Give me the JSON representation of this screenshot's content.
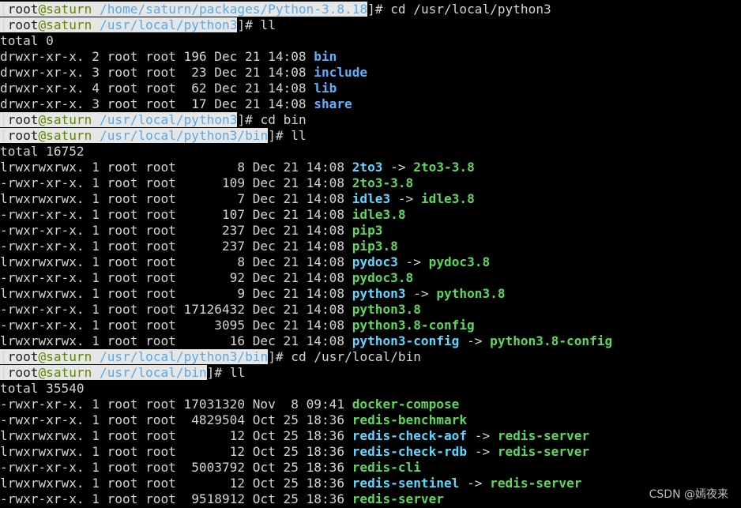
{
  "terminal": {
    "lines": [
      {
        "type": "prompt",
        "user": "root",
        "host": "saturn",
        "path": "/home/saturn/packages/Python-3.8.18",
        "cmd": "cd /usr/local/python3"
      },
      {
        "type": "prompt",
        "user": "root",
        "host": "saturn",
        "path": "/usr/local/python3",
        "cmd": "ll"
      },
      {
        "type": "text",
        "text": "total 0"
      },
      {
        "type": "entry",
        "meta": "drwxr-xr-x. 2 root root 196 Dec 21 14:08 ",
        "name": "bin",
        "kind": "dir"
      },
      {
        "type": "entry",
        "meta": "drwxr-xr-x. 3 root root  23 Dec 21 14:08 ",
        "name": "include",
        "kind": "dir"
      },
      {
        "type": "entry",
        "meta": "drwxr-xr-x. 4 root root  62 Dec 21 14:08 ",
        "name": "lib",
        "kind": "dir"
      },
      {
        "type": "entry",
        "meta": "drwxr-xr-x. 3 root root  17 Dec 21 14:08 ",
        "name": "share",
        "kind": "dir"
      },
      {
        "type": "prompt",
        "user": "root",
        "host": "saturn",
        "path": "/usr/local/python3",
        "cmd": "cd bin"
      },
      {
        "type": "prompt",
        "user": "root",
        "host": "saturn",
        "path": "/usr/local/python3/bin",
        "cmd": "ll"
      },
      {
        "type": "text",
        "text": "total 16752"
      },
      {
        "type": "entry",
        "meta": "lrwxrwxrwx. 1 root root        8 Dec 21 14:08 ",
        "name": "2to3",
        "kind": "link",
        "arrow": " -> ",
        "target": "2to3-3.8"
      },
      {
        "type": "entry",
        "meta": "-rwxr-xr-x. 1 root root      109 Dec 21 14:08 ",
        "name": "2to3-3.8",
        "kind": "exe"
      },
      {
        "type": "entry",
        "meta": "lrwxrwxrwx. 1 root root        7 Dec 21 14:08 ",
        "name": "idle3",
        "kind": "link",
        "arrow": " -> ",
        "target": "idle3.8"
      },
      {
        "type": "entry",
        "meta": "-rwxr-xr-x. 1 root root      107 Dec 21 14:08 ",
        "name": "idle3.8",
        "kind": "exe"
      },
      {
        "type": "entry",
        "meta": "-rwxr-xr-x. 1 root root      237 Dec 21 14:08 ",
        "name": "pip3",
        "kind": "exe"
      },
      {
        "type": "entry",
        "meta": "-rwxr-xr-x. 1 root root      237 Dec 21 14:08 ",
        "name": "pip3.8",
        "kind": "exe"
      },
      {
        "type": "entry",
        "meta": "lrwxrwxrwx. 1 root root        8 Dec 21 14:08 ",
        "name": "pydoc3",
        "kind": "link",
        "arrow": " -> ",
        "target": "pydoc3.8"
      },
      {
        "type": "entry",
        "meta": "-rwxr-xr-x. 1 root root       92 Dec 21 14:08 ",
        "name": "pydoc3.8",
        "kind": "exe"
      },
      {
        "type": "entry",
        "meta": "lrwxrwxrwx. 1 root root        9 Dec 21 14:08 ",
        "name": "python3",
        "kind": "link",
        "arrow": " -> ",
        "target": "python3.8"
      },
      {
        "type": "entry",
        "meta": "-rwxr-xr-x. 1 root root 17126432 Dec 21 14:08 ",
        "name": "python3.8",
        "kind": "exe"
      },
      {
        "type": "entry",
        "meta": "-rwxr-xr-x. 1 root root     3095 Dec 21 14:08 ",
        "name": "python3.8-config",
        "kind": "exe"
      },
      {
        "type": "entry",
        "meta": "lrwxrwxrwx. 1 root root       16 Dec 21 14:08 ",
        "name": "python3-config",
        "kind": "link",
        "arrow": " -> ",
        "target": "python3.8-config"
      },
      {
        "type": "prompt",
        "user": "root",
        "host": "saturn",
        "path": "/usr/local/python3/bin",
        "cmd": "cd /usr/local/bin"
      },
      {
        "type": "prompt",
        "user": "root",
        "host": "saturn",
        "path": "/usr/local/bin",
        "cmd": "ll"
      },
      {
        "type": "text",
        "text": "total 35540"
      },
      {
        "type": "entry",
        "meta": "-rwxr-xr-x. 1 root root 17031320 Nov  8 09:41 ",
        "name": "docker-compose",
        "kind": "exe"
      },
      {
        "type": "entry",
        "meta": "-rwxr-xr-x. 1 root root  4829504 Oct 25 18:36 ",
        "name": "redis-benchmark",
        "kind": "exe"
      },
      {
        "type": "entry",
        "meta": "lrwxrwxrwx. 1 root root       12 Oct 25 18:36 ",
        "name": "redis-check-aof",
        "kind": "link",
        "arrow": " -> ",
        "target": "redis-server"
      },
      {
        "type": "entry",
        "meta": "lrwxrwxrwx. 1 root root       12 Oct 25 18:36 ",
        "name": "redis-check-rdb",
        "kind": "link",
        "arrow": " -> ",
        "target": "redis-server"
      },
      {
        "type": "entry",
        "meta": "-rwxr-xr-x. 1 root root  5003792 Oct 25 18:36 ",
        "name": "redis-cli",
        "kind": "exe"
      },
      {
        "type": "entry",
        "meta": "lrwxrwxrwx. 1 root root       12 Oct 25 18:36 ",
        "name": "redis-sentinel",
        "kind": "link",
        "arrow": " -> ",
        "target": "redis-server"
      },
      {
        "type": "entry",
        "meta": "-rwxr-xr-x. 1 root root  9518912 Oct 25 18:36 ",
        "name": "redis-server",
        "kind": "exe"
      }
    ]
  },
  "watermark": "CSDN @嫣夜来",
  "colors": {
    "background": "#000000",
    "text": "#d4d4d4",
    "prompt_bg": "#e6e6e6",
    "host": "#5f8700",
    "path": "#5aa9e6",
    "dir": "#5fafff",
    "exe": "#5fd75f",
    "link": "#5fd7ff"
  }
}
